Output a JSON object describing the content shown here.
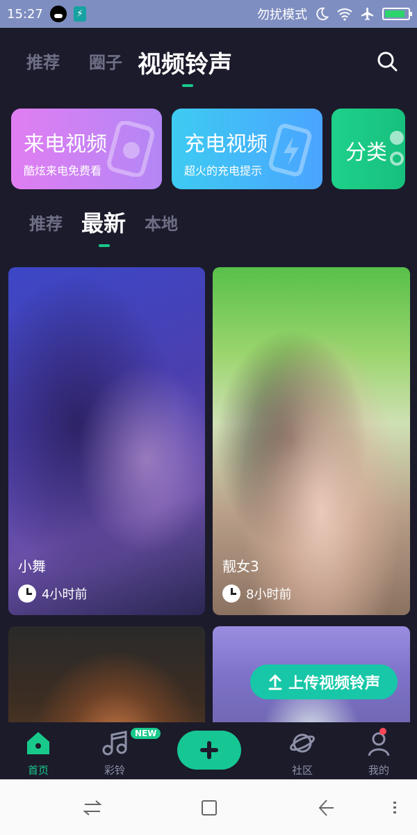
{
  "status_bar": {
    "time": "15:27",
    "dnd_text": "勿扰模式",
    "icons": [
      "qq-icon",
      "usb-icon",
      "moon-icon",
      "wifi-icon",
      "airplane-icon",
      "battery-icon"
    ]
  },
  "top_tabs": [
    {
      "label": "推荐",
      "active": false
    },
    {
      "label": "圈子",
      "active": false
    },
    {
      "label": "视频铃声",
      "active": true
    }
  ],
  "feature_cards": [
    {
      "title": "来电视频",
      "subtitle": "酷炫来电免费看",
      "colors": [
        "#e07ef2",
        "#b386f5"
      ],
      "icon": "phone-video-icon"
    },
    {
      "title": "充电视频",
      "subtitle": "超火的充电提示",
      "colors": [
        "#3ecbf2",
        "#4aa4ff"
      ],
      "icon": "battery-charge-icon"
    },
    {
      "title": "分类",
      "subtitle": "",
      "colors": [
        "#1ed18a",
        "#17c07d"
      ],
      "icon": "category-icon"
    }
  ],
  "sub_tabs": [
    {
      "label": "推荐",
      "active": false
    },
    {
      "label": "最新",
      "active": true
    },
    {
      "label": "本地",
      "active": false
    }
  ],
  "videos": [
    {
      "title": "小舞",
      "time": "4小时前"
    },
    {
      "title": "靓女3",
      "time": "8小时前"
    },
    {
      "title": "",
      "time": ""
    },
    {
      "title": "",
      "time": ""
    }
  ],
  "upload_button": {
    "label": "上传视频铃声"
  },
  "bottom_nav": [
    {
      "label": "首页",
      "icon": "home-icon",
      "active": true
    },
    {
      "label": "彩铃",
      "icon": "music-icon",
      "active": false,
      "badge": "NEW"
    },
    {
      "label": "",
      "icon": "plus-icon",
      "active": false
    },
    {
      "label": "社区",
      "icon": "planet-icon",
      "active": false
    },
    {
      "label": "我的",
      "icon": "profile-icon",
      "active": false
    }
  ],
  "colors": {
    "background": "#1c1b2b",
    "accent": "#18c98b",
    "status_bar": "#7f8ec0"
  }
}
